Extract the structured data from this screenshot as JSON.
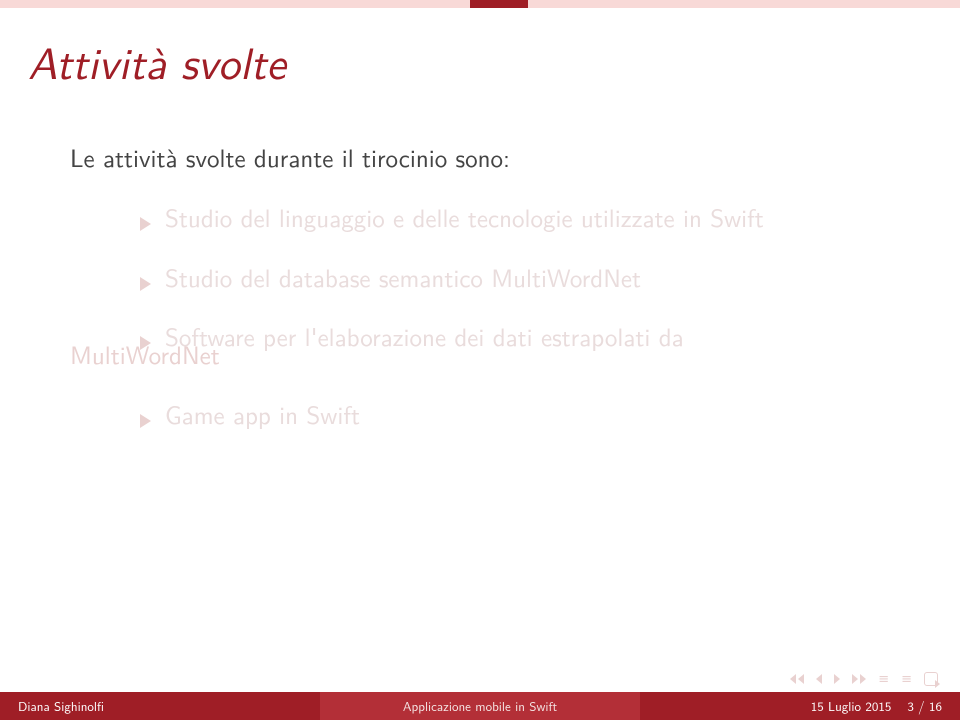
{
  "colors": {
    "accent": "#9f1e26",
    "accent_light": "#b32f37",
    "faded": "#e9dcdc",
    "faded_link": "#e9d1d0"
  },
  "progress": {
    "done_fraction": 0.49
  },
  "title": "Attività svolte",
  "intro": "Le attività svolte durante il tirocinio sono:",
  "bullets": [
    {
      "text": "Studio del linguaggio e delle tecnologie utilizzate in Swift",
      "active": false
    },
    {
      "text": "Studio del database semantico MultiWordNet",
      "active": false
    },
    {
      "text_pre": "Software per l'elaborazione dei dati estrapolati da",
      "text_cont": "MultiWordNet",
      "active": false
    },
    {
      "text": "Game app in Swift",
      "active": false
    }
  ],
  "footer": {
    "author": "Diana Sighinolfi",
    "talk": "Applicazione mobile in Swift",
    "date": "15 Luglio 2015",
    "page": "3 / 16"
  },
  "nav": {
    "first": "first-slide",
    "prev": "prev-slide",
    "next": "next-slide",
    "last": "last-slide",
    "goto": "goto-slide",
    "loop": "restart"
  }
}
